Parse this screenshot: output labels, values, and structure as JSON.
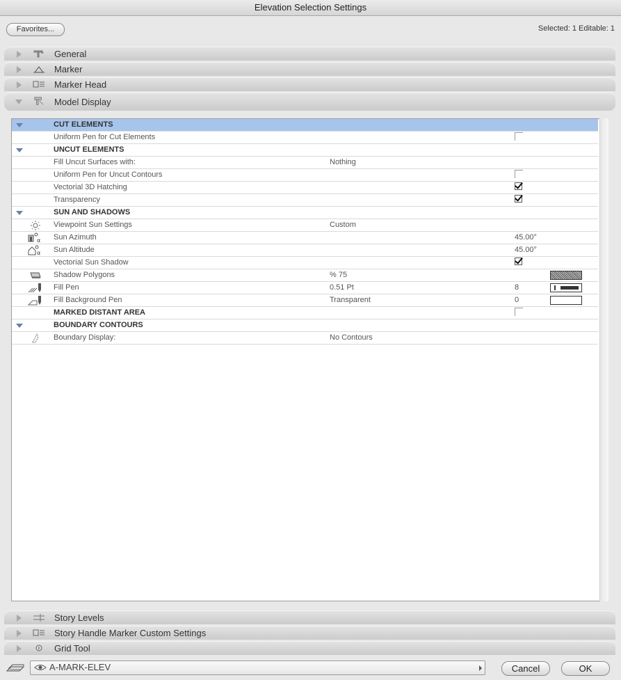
{
  "window": {
    "title": "Elevation Selection Settings"
  },
  "topbar": {
    "favorites_label": "Favorites...",
    "selection_info": "Selected: 1 Editable: 1"
  },
  "sections_top": [
    {
      "label": "General",
      "icon": "general-icon"
    },
    {
      "label": "Marker",
      "icon": "marker-icon"
    },
    {
      "label": "Marker Head",
      "icon": "marker-head-icon"
    },
    {
      "label": "Model Display",
      "icon": "model-display-icon",
      "expanded": true
    }
  ],
  "rows": [
    {
      "type": "group",
      "label": "CUT ELEMENTS",
      "highlighted": true
    },
    {
      "type": "item",
      "label": "Uniform Pen for Cut Elements",
      "checkbox": false
    },
    {
      "type": "group",
      "label": "UNCUT ELEMENTS"
    },
    {
      "type": "item",
      "label": "Fill Uncut Surfaces with:",
      "value": "Nothing"
    },
    {
      "type": "item",
      "label": "Uniform Pen for Uncut Contours",
      "checkbox": false
    },
    {
      "type": "item",
      "label": "Vectorial 3D Hatching",
      "checkbox": true
    },
    {
      "type": "item",
      "label": "Transparency",
      "checkbox": true
    },
    {
      "type": "group",
      "label": "SUN AND SHADOWS"
    },
    {
      "type": "item",
      "label": "Viewpoint Sun Settings",
      "value": "Custom",
      "icon": "sun-icon"
    },
    {
      "type": "item",
      "label": "Sun Azimuth",
      "value2": "45.00°",
      "icon": "sun-azimuth-icon"
    },
    {
      "type": "item",
      "label": "Sun Altitude",
      "value2": "45.00°",
      "icon": "sun-altitude-icon"
    },
    {
      "type": "item",
      "label": "Vectorial Sun Shadow",
      "checkbox": true
    },
    {
      "type": "item",
      "label": "Shadow Polygons",
      "value": "%  75",
      "icon": "shadow-polygons-icon",
      "swatch": "hatch"
    },
    {
      "type": "item",
      "label": "Fill Pen",
      "value": "0.51 Pt",
      "value2": "8",
      "icon": "fill-pen-icon",
      "swatch": "pen"
    },
    {
      "type": "item",
      "label": "Fill Background Pen",
      "value": "Transparent",
      "value2": "0",
      "icon": "fill-background-pen-icon",
      "swatch": "empty"
    },
    {
      "type": "group-nocollapse",
      "label": "MARKED DISTANT AREA",
      "checkbox": false
    },
    {
      "type": "group",
      "label": "BOUNDARY CONTOURS"
    },
    {
      "type": "item",
      "label": "Boundary Display:",
      "value": "No Contours",
      "icon": "boundary-icon"
    }
  ],
  "sections_bottom": [
    {
      "label": "Story Levels",
      "icon": "story-levels-icon"
    },
    {
      "label": "Story Handle Marker Custom Settings",
      "icon": "story-handle-icon"
    },
    {
      "label": "Grid Tool",
      "icon": "grid-tool-icon"
    }
  ],
  "bottombar": {
    "layer_name": "A-MARK-ELEV",
    "cancel_label": "Cancel",
    "ok_label": "OK"
  }
}
